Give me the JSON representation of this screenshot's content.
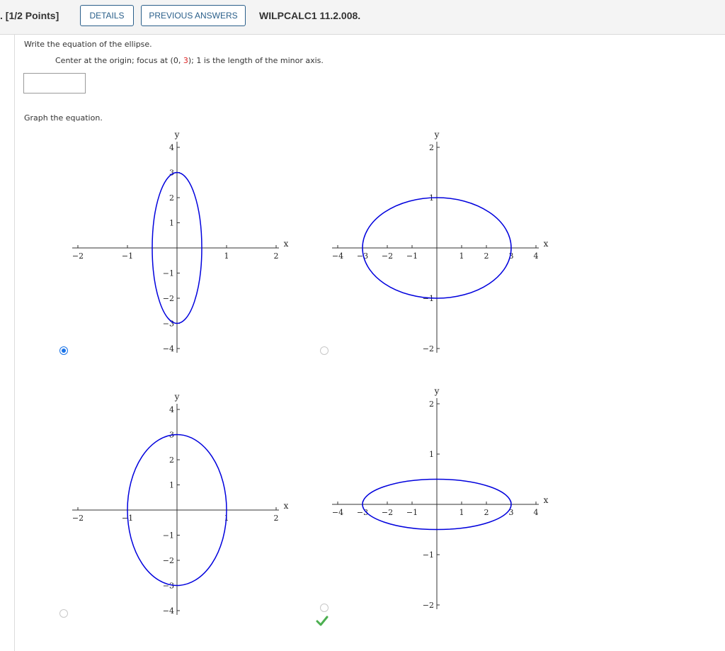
{
  "header": {
    "points": ". [1/2 Points]",
    "details_label": "DETAILS",
    "previous_answers_label": "PREVIOUS ANSWERS",
    "question_code": "WILPCALC1 11.2.008."
  },
  "question": {
    "prompt": "Write the equation of the ellipse.",
    "given_pre": "Center at the origin; focus at (0, ",
    "given_focus_y": "3",
    "given_post": "); 1 is the length of the minor axis.",
    "answer_value": "",
    "graph_prompt": "Graph the equation."
  },
  "graphs": [
    {
      "id": "A",
      "selected": true,
      "correct_mark": false,
      "x_range": [
        -2,
        2
      ],
      "y_range": [
        -4,
        4
      ],
      "x_ticks": [
        "−2",
        "−1",
        "1",
        "2"
      ],
      "y_ticks": [
        "4",
        "3",
        "2",
        "1",
        "−1",
        "−2",
        "−3",
        "−4"
      ],
      "x_label": "x",
      "y_label": "y",
      "ellipse": {
        "a_x": 0.5,
        "b_y": 3
      }
    },
    {
      "id": "B",
      "selected": false,
      "correct_mark": false,
      "x_range": [
        -4,
        4
      ],
      "y_range": [
        -2,
        2
      ],
      "x_ticks": [
        "−4",
        "−3",
        "−2",
        "−1",
        "1",
        "2",
        "3",
        "4"
      ],
      "y_ticks": [
        "2",
        "1",
        "−1",
        "−2"
      ],
      "x_label": "x",
      "y_label": "y",
      "ellipse": {
        "a_x": 3,
        "b_y": 1
      }
    },
    {
      "id": "C",
      "selected": false,
      "correct_mark": false,
      "x_range": [
        -2,
        2
      ],
      "y_range": [
        -4,
        4
      ],
      "x_ticks": [
        "−2",
        "−1",
        "1",
        "2"
      ],
      "y_ticks": [
        "4",
        "3",
        "2",
        "1",
        "−1",
        "−2",
        "−3",
        "−4"
      ],
      "x_label": "x",
      "y_label": "y",
      "ellipse": {
        "a_x": 1,
        "b_y": 3
      }
    },
    {
      "id": "D",
      "selected": false,
      "correct_mark": true,
      "x_range": [
        -4,
        4
      ],
      "y_range": [
        -2,
        2
      ],
      "x_ticks": [
        "−4",
        "−3",
        "−2",
        "−1",
        "1",
        "2",
        "3",
        "4"
      ],
      "y_ticks": [
        "2",
        "1",
        "−1",
        "−2"
      ],
      "x_label": "x",
      "y_label": "y",
      "ellipse": {
        "a_x": 3,
        "b_y": 0.5
      }
    }
  ],
  "colors": {
    "ellipse": "#0000dd",
    "accent": "#2a5f8a",
    "focus_red": "#dd2222",
    "check_green": "#4caf50"
  }
}
